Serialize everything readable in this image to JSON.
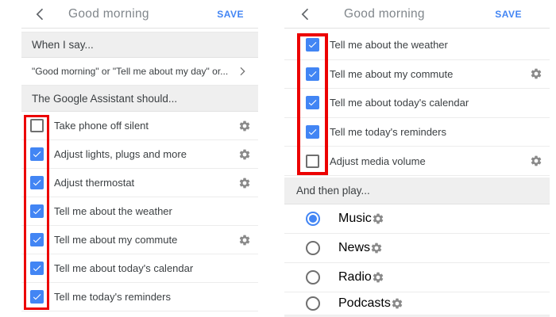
{
  "colors": {
    "accent_blue": "#4285f4",
    "highlight_red": "#ec0000",
    "title_gray": "#80868b",
    "section_bar_gray": "#efefef",
    "icon_gray": "#8a8a8a"
  },
  "icons": {
    "back": "chevron-left-icon",
    "forward": "chevron-right-icon",
    "settings": "gear-icon",
    "checked_checkbox": "blue-checked-checkbox",
    "selected_radio": "blue-selected-radio"
  },
  "left_screen": {
    "header": {
      "title": "Good morning",
      "save": "SAVE"
    },
    "section_when": "When I say...",
    "trigger_row": "\"Good morning\" or \"Tell me about my day\" or...",
    "section_should": "The Google Assistant should...",
    "items": [
      {
        "label": "Take phone off silent",
        "checked": false,
        "gear": true
      },
      {
        "label": "Adjust lights, plugs and more",
        "checked": true,
        "gear": true
      },
      {
        "label": "Adjust thermostat",
        "checked": true,
        "gear": true
      },
      {
        "label": "Tell me about the weather",
        "checked": true,
        "gear": false
      },
      {
        "label": "Tell me about my commute",
        "checked": true,
        "gear": true
      },
      {
        "label": "Tell me about today's calendar",
        "checked": true,
        "gear": false
      },
      {
        "label": "Tell me today's reminders",
        "checked": true,
        "gear": false
      }
    ]
  },
  "right_screen": {
    "header": {
      "title": "Good morning",
      "save": "SAVE"
    },
    "items": [
      {
        "label": "Tell me about the weather",
        "checked": true,
        "gear": false
      },
      {
        "label": "Tell me about my commute",
        "checked": true,
        "gear": true
      },
      {
        "label": "Tell me about today's calendar",
        "checked": true,
        "gear": false
      },
      {
        "label": "Tell me today's reminders",
        "checked": true,
        "gear": false
      },
      {
        "label": "Adjust media volume",
        "checked": false,
        "gear": true
      }
    ],
    "section_play": "And then play...",
    "play_options": [
      {
        "label": "Music",
        "selected": true
      },
      {
        "label": "News",
        "selected": false
      },
      {
        "label": "Radio",
        "selected": false
      },
      {
        "label": "Podcasts",
        "selected": false
      }
    ]
  }
}
